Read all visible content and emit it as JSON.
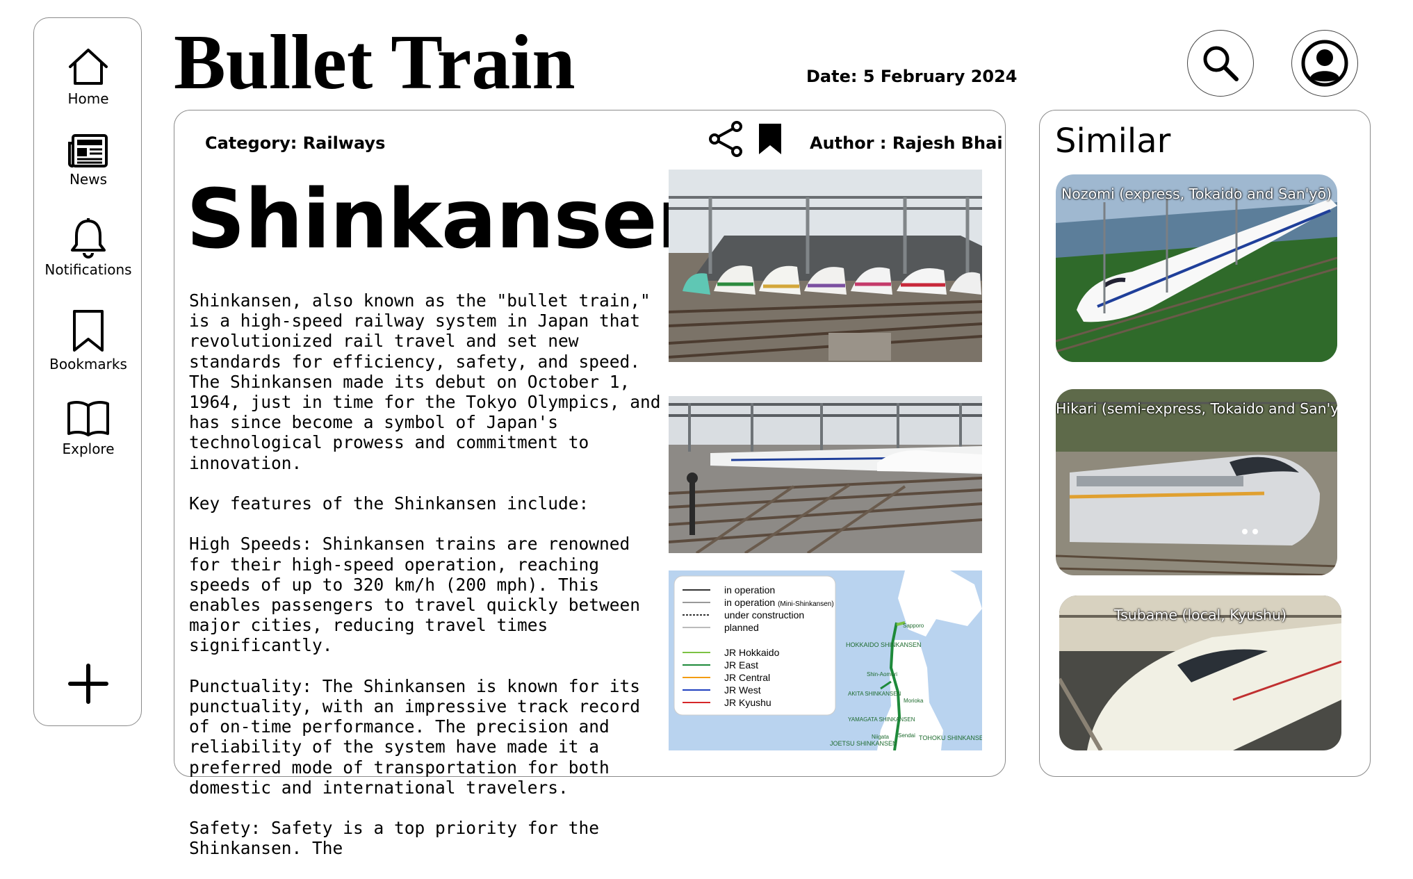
{
  "sidebar": {
    "items": [
      {
        "label": "Home",
        "icon": "home-icon"
      },
      {
        "label": "News",
        "icon": "newspaper-icon"
      },
      {
        "label": "Notifications",
        "icon": "bell-icon"
      },
      {
        "label": "Bookmarks",
        "icon": "bookmark-icon"
      },
      {
        "label": "Explore",
        "icon": "open-book-icon"
      }
    ],
    "add_icon": "plus-icon"
  },
  "header": {
    "title": "Bullet Train",
    "date": "Date: 5 February 2024",
    "search_icon": "search-icon",
    "profile_icon": "user-profile-icon"
  },
  "article": {
    "category": "Category: Railways",
    "author": "Author : Rajesh Bhai",
    "share_icon": "share-icon",
    "bookmark_icon": "bookmark-icon",
    "title": "Shinkansen",
    "paragraphs": [
      "Shinkansen, also known as the \"bullet train,\" is a high-speed railway system in Japan that revolutionized rail travel and set new standards for efficiency, safety, and speed. The Shinkansen made its debut on October 1, 1964, just in time for the Tokyo Olympics, and has since become a symbol of Japan's technological prowess and commitment to innovation.",
      "Key features of the Shinkansen include:",
      "High Speeds: Shinkansen trains are renowned for their high-speed operation, reaching speeds of up to 320 km/h (200 mph). This enables passengers to travel quickly between major cities, reducing travel times significantly.",
      "Punctuality: The Shinkansen is known for its punctuality, with an impressive track record of on-time performance. The precision and reliability of the system have made it a preferred mode of transportation for both domestic and international travelers.",
      "Safety: Safety is a top priority for the Shinkansen. The"
    ],
    "map": {
      "legend_status": [
        "in operation",
        "in operation",
        "under construction",
        "planned"
      ],
      "legend_status_note": "(Mini-Shinkansen)",
      "legend_operators": [
        {
          "name": "JR Hokkaido",
          "color": "#7cc243"
        },
        {
          "name": "JR East",
          "color": "#1e8a3a"
        },
        {
          "name": "JR Central",
          "color": "#f39c12"
        },
        {
          "name": "JR West",
          "color": "#1f3fbf"
        },
        {
          "name": "JR Kyushu",
          "color": "#d62728"
        }
      ],
      "place_labels": [
        "Sapporo",
        "HOKKAIDO SHINKANSEN",
        "Shin-Aomori",
        "AKITA SHINKANSEN",
        "Morioka",
        "YAMAGATA SHINKANSEN",
        "Sendai",
        "TOHOKU SHINKANSEN",
        "JOETSU SHINKANSEN",
        "Niigata"
      ]
    }
  },
  "similar": {
    "heading": "Similar",
    "items": [
      {
        "caption": "Nozomi (express, Tokaido and San'yō)"
      },
      {
        "caption": "Hikari (semi-express, Tokaido and San'yō)"
      },
      {
        "caption": "Tsubame (local, Kyushu)"
      }
    ]
  }
}
